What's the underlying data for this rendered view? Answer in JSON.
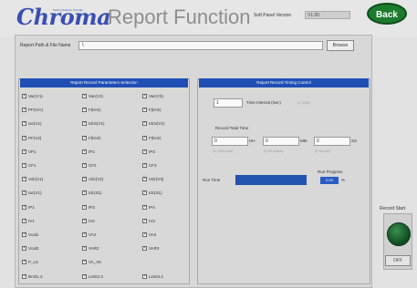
{
  "header": {
    "logo": "Chroma",
    "logo_sub": "Testing Solution Provider",
    "title": "Report Function",
    "version_label": "Soft Panel Version",
    "version_value": "V1.00",
    "back_label": "Back"
  },
  "path": {
    "label": "Report Path & File Name",
    "value": "\\",
    "browse_label": "Browse"
  },
  "left_panel": {
    "title": "Report Record Parameters Selection",
    "columns": [
      [
        "Vac(V1)",
        "PF(V/A)",
        "Iac(V1)",
        "PF(V2)",
        "VP1",
        "CF1",
        "Vdc(V1)",
        "Iac(V1)",
        "IP1",
        "IV1",
        "Vcal1",
        "Vcal3",
        "P_LS",
        "Ilimit1.2"
      ],
      [
        "Vac(V2)",
        "F(kHz)",
        "IdcS(V1)",
        "F(kHz)",
        "IP2",
        "CF2",
        "Vdc(V2)",
        "Idc(S1)",
        "IP3",
        "IV2",
        "VA2",
        "VAR2",
        "VA_AK",
        "Limit2.3"
      ],
      [
        "Vac(V3)",
        "F(kHz)",
        "IdcS(V1)",
        "F(kHz)",
        "IP3",
        "CF3",
        "Vdc(V3)",
        "Idc(S1)",
        "IP4",
        "IV3",
        "VA3",
        "VAR3",
        "",
        "Limit3.4"
      ]
    ]
  },
  "right_panel": {
    "title": "Report Record Timing Control",
    "interval_value": "1",
    "interval_label": "Time Interval (Sec)",
    "interval_hint": "(1~1000)",
    "total_time_label": "Record Total Time",
    "hours_value": "0",
    "hours_unit": "HH",
    "hours_hint": "(0~1000 hour)",
    "minutes_value": "0",
    "minutes_unit": "MM",
    "minutes_hint": "(0~59 minute)",
    "seconds_value": "0",
    "seconds_unit": "SS",
    "seconds_hint": "(0~59 sec)",
    "run_time_label": "Run Time",
    "run_progress_label": "Run Progress",
    "progress_value": "0.00",
    "progress_unit": "%"
  },
  "side": {
    "record_label": "Record Start",
    "off_label": "OFF"
  }
}
